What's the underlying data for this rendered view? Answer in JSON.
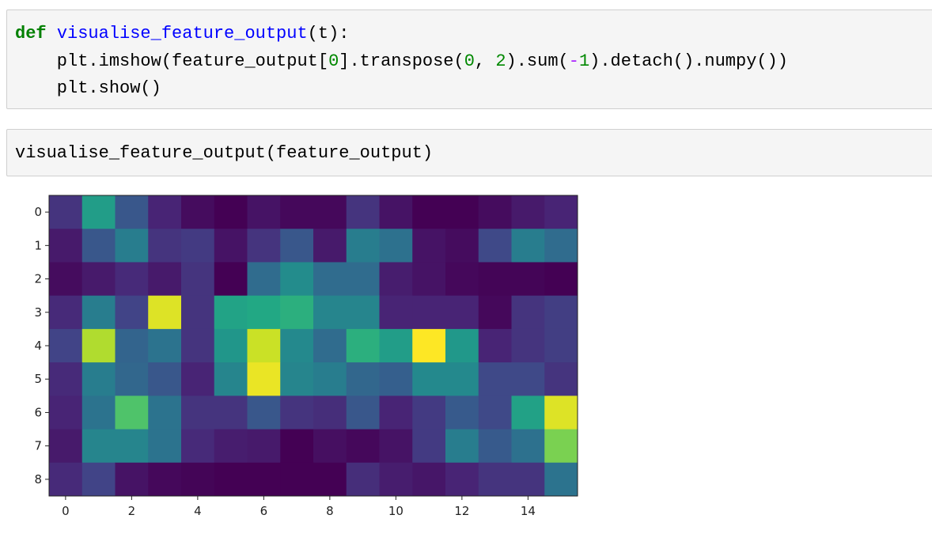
{
  "cells": [
    {
      "lines": [
        [
          {
            "t": "def",
            "k": "kw"
          },
          {
            "t": " ",
            "k": ""
          },
          {
            "t": "visualise_feature_output",
            "k": "fn"
          },
          {
            "t": "(t):",
            "k": ""
          }
        ],
        [
          {
            "t": "    plt.imshow(feature_output[",
            "k": ""
          },
          {
            "t": "0",
            "k": "num"
          },
          {
            "t": "].transpose(",
            "k": ""
          },
          {
            "t": "0",
            "k": "num"
          },
          {
            "t": ", ",
            "k": ""
          },
          {
            "t": "2",
            "k": "num"
          },
          {
            "t": ").sum(",
            "k": ""
          },
          {
            "t": "-",
            "k": "op"
          },
          {
            "t": "1",
            "k": "num"
          },
          {
            "t": ").detach().numpy())",
            "k": ""
          }
        ],
        [
          {
            "t": "    plt.show()",
            "k": ""
          }
        ]
      ]
    },
    {
      "lines": [
        [
          {
            "t": "visualise_feature_output(feature_output)",
            "k": ""
          }
        ]
      ]
    }
  ],
  "chart_data": {
    "type": "heatmap",
    "colormap": "viridis",
    "title": "",
    "xlabel": "",
    "ylabel": "",
    "x_ticks": [
      "0",
      "2",
      "4",
      "6",
      "8",
      "10",
      "12",
      "14"
    ],
    "y_ticks": [
      "0",
      "1",
      "2",
      "3",
      "4",
      "5",
      "6",
      "7",
      "8"
    ],
    "rows": 9,
    "cols": 16,
    "values_normalized": [
      [
        0.15,
        0.55,
        0.27,
        0.1,
        0.03,
        0.0,
        0.05,
        0.02,
        0.02,
        0.15,
        0.05,
        0.0,
        0.0,
        0.03,
        0.07,
        0.1
      ],
      [
        0.07,
        0.27,
        0.42,
        0.15,
        0.17,
        0.05,
        0.15,
        0.27,
        0.07,
        0.42,
        0.37,
        0.05,
        0.03,
        0.22,
        0.42,
        0.35
      ],
      [
        0.03,
        0.07,
        0.12,
        0.07,
        0.15,
        0.0,
        0.35,
        0.48,
        0.35,
        0.35,
        0.08,
        0.05,
        0.02,
        0.01,
        0.01,
        0.0
      ],
      [
        0.12,
        0.42,
        0.2,
        0.95,
        0.15,
        0.58,
        0.6,
        0.63,
        0.45,
        0.45,
        0.1,
        0.1,
        0.1,
        0.02,
        0.15,
        0.18
      ],
      [
        0.2,
        0.88,
        0.32,
        0.38,
        0.15,
        0.52,
        0.92,
        0.47,
        0.35,
        0.63,
        0.55,
        1.0,
        0.53,
        0.1,
        0.15,
        0.18
      ],
      [
        0.12,
        0.42,
        0.33,
        0.27,
        0.1,
        0.45,
        0.97,
        0.45,
        0.42,
        0.33,
        0.3,
        0.47,
        0.47,
        0.22,
        0.22,
        0.15
      ],
      [
        0.1,
        0.38,
        0.72,
        0.38,
        0.15,
        0.15,
        0.27,
        0.15,
        0.13,
        0.27,
        0.1,
        0.17,
        0.28,
        0.22,
        0.57,
        0.95
      ],
      [
        0.07,
        0.45,
        0.45,
        0.38,
        0.12,
        0.08,
        0.07,
        0.0,
        0.04,
        0.02,
        0.05,
        0.17,
        0.42,
        0.28,
        0.37,
        0.8
      ],
      [
        0.12,
        0.2,
        0.05,
        0.02,
        0.01,
        0.0,
        0.0,
        0.0,
        0.0,
        0.13,
        0.08,
        0.06,
        0.1,
        0.15,
        0.15,
        0.38
      ]
    ]
  }
}
